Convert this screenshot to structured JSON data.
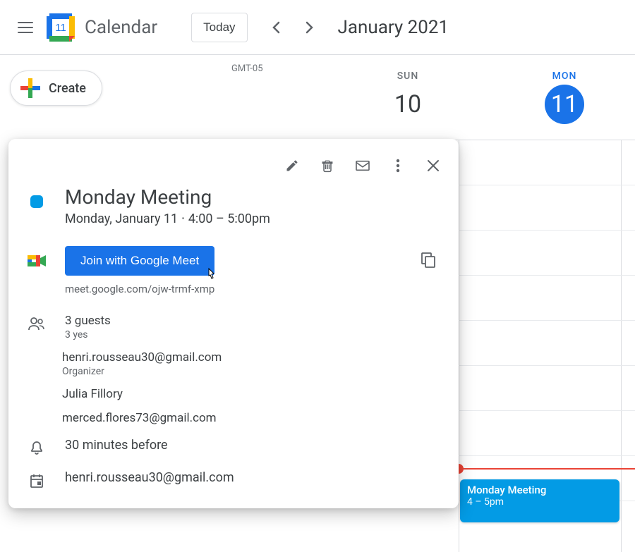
{
  "header": {
    "app_name": "Calendar",
    "logo_day": "11",
    "today_label": "Today",
    "date_range": "January 2021"
  },
  "create": {
    "label": "Create"
  },
  "timezone": "GMT-05",
  "days": [
    {
      "abbr": "SUN",
      "num": "10",
      "is_today": false
    },
    {
      "abbr": "MON",
      "num": "11",
      "is_today": true
    }
  ],
  "grid_event": {
    "title": "Monday Meeting",
    "time": "4 – 5pm"
  },
  "popup": {
    "title": "Monday Meeting",
    "datetime": "Monday, January 11  ⋅  4:00 – 5:00pm",
    "join_label": "Join with Google Meet",
    "meet_url": "meet.google.com/ojw-trmf-xmp",
    "guests_count": "3 guests",
    "guests_status": "3 yes",
    "guests": [
      {
        "email": "henri.rousseau30@gmail.com",
        "role": "Organizer"
      },
      {
        "email": "Julia Fillory",
        "role": ""
      },
      {
        "email": "merced.flores73@gmail.com",
        "role": ""
      }
    ],
    "reminder": "30 minutes before",
    "calendar_owner": "henri.rousseau30@gmail.com"
  },
  "colors": {
    "event_blue": "#039be5",
    "primary_blue": "#1a73e8",
    "red": "#ea4335"
  }
}
